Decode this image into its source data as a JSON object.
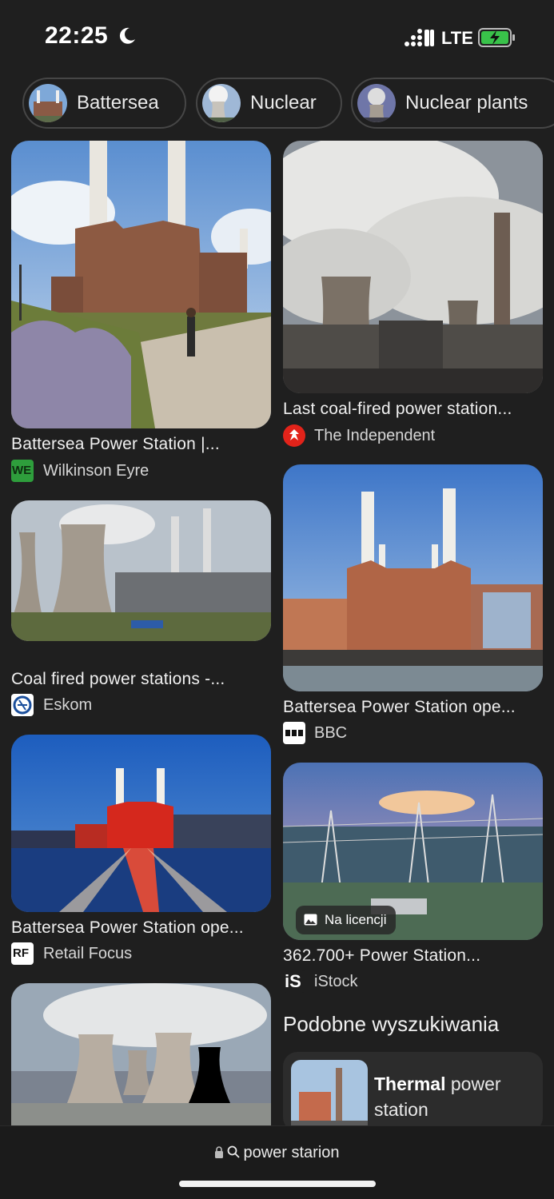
{
  "status_bar": {
    "time": "22:25",
    "network": "LTE"
  },
  "chips": [
    {
      "label": "Battersea"
    },
    {
      "label": "Nuclear"
    },
    {
      "label": "Nuclear plants"
    }
  ],
  "results": [
    {
      "caption": "Battersea Power Station |...",
      "source": "Wilkinson Eyre",
      "favicon_text": "WE"
    },
    {
      "caption": "Last coal-fired power station...",
      "source": "The Independent"
    },
    {
      "caption": "Coal fired power stations -...",
      "source": "Eskom"
    },
    {
      "caption": "Battersea Power Station ope...",
      "source": "BBC"
    },
    {
      "caption": "Battersea Power Station ope...",
      "source": "Retail Focus",
      "favicon_text": "RF"
    },
    {
      "caption": "362.700+ Power Station...",
      "source": "iStock",
      "favicon_text": "iS",
      "badge": "Na licencji"
    },
    {
      "caption": "",
      "source": ""
    }
  ],
  "related": {
    "heading": "Podobne wyszukiwania",
    "items": [
      {
        "bold": "Thermal",
        "rest": "power",
        "line2": "station"
      }
    ]
  },
  "browser": {
    "url": "power starion"
  },
  "colors": {
    "background": "#1f1f1f",
    "chip_border": "#464646",
    "card_bg": "#2c2c2c"
  }
}
